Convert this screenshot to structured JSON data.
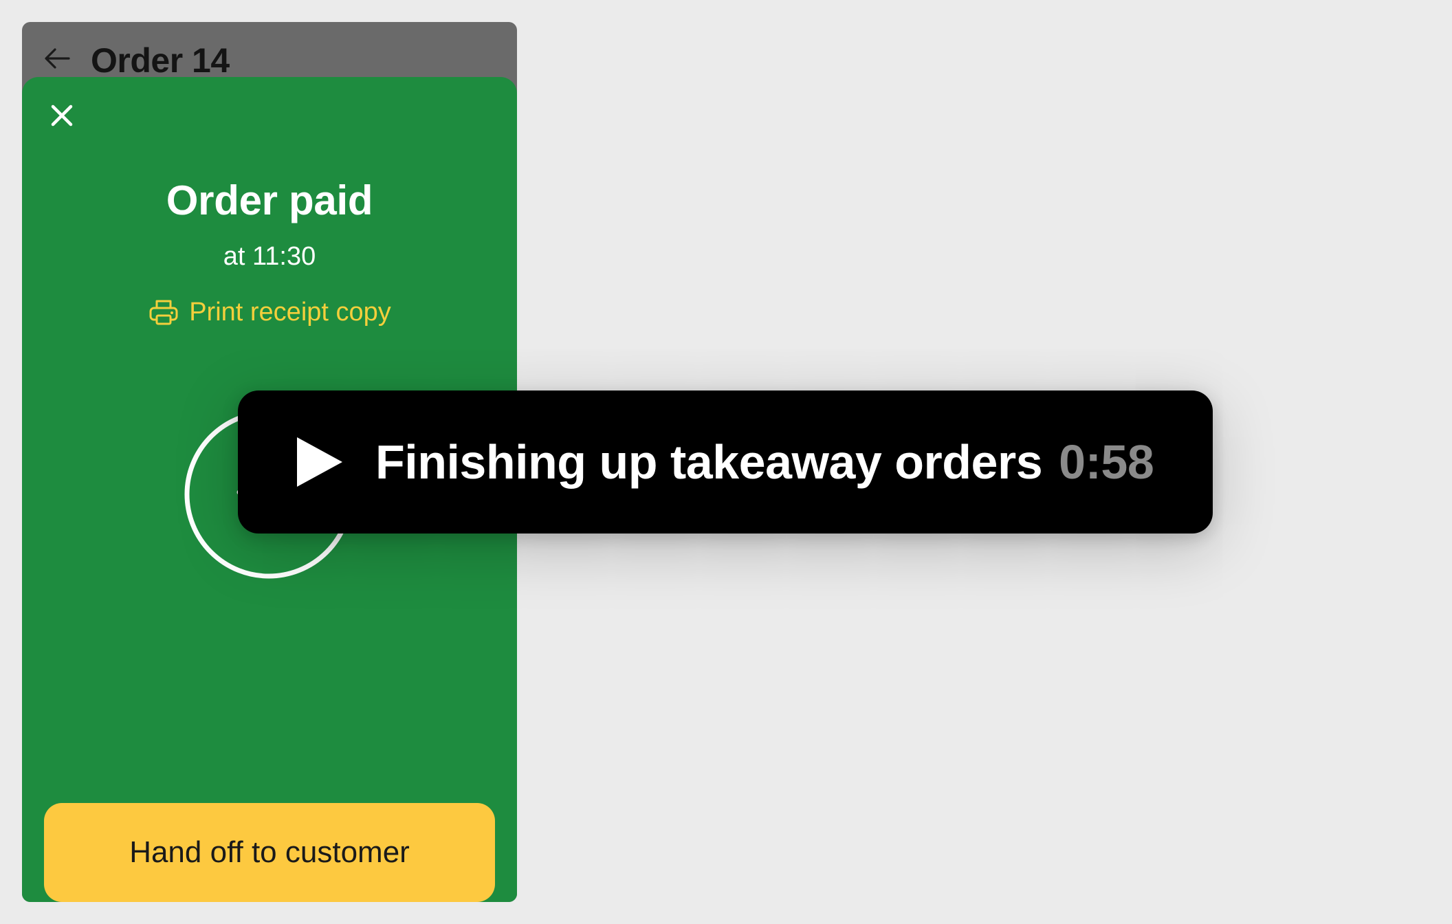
{
  "header": {
    "title": "Order 14"
  },
  "sheet": {
    "title": "Order paid",
    "subtitle": "at 11:30",
    "print_label": "Print receipt copy",
    "primary_button_label": "Hand off to customer"
  },
  "overlay": {
    "title": "Finishing up takeaway orders",
    "time": "0:58"
  },
  "icons": {
    "back": "back-arrow-icon",
    "close": "close-icon",
    "print": "printer-icon",
    "status": "check-circle-icon",
    "play": "play-icon"
  },
  "colors": {
    "background": "#ebebeb",
    "header": "#6a6a6a",
    "sheet": "#1e8c3f",
    "accent_yellow": "#fdc940",
    "link_yellow": "#f4cf3c",
    "overlay": "#000000",
    "overlay_time": "#8a8a8a"
  }
}
